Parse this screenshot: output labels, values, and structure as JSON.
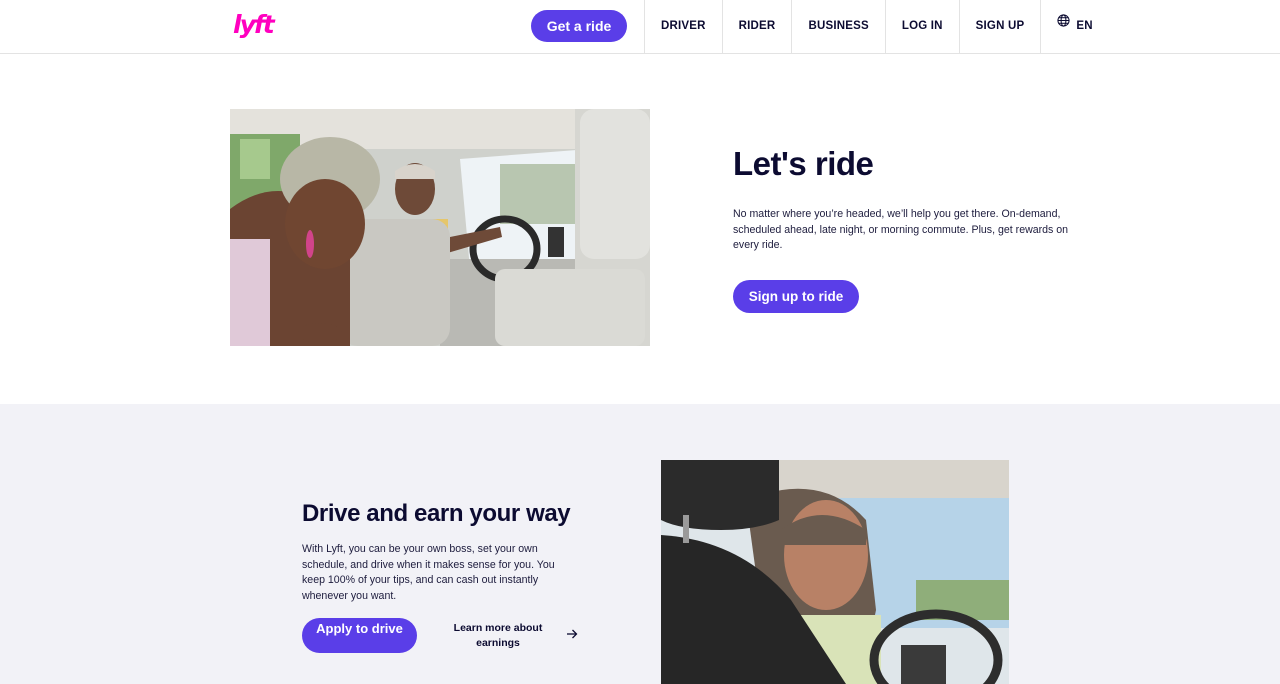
{
  "header": {
    "logo_text": "lyft",
    "get_ride_label": "Get a ride",
    "nav": [
      "DRIVER",
      "RIDER",
      "BUSINESS",
      "LOG IN",
      "SIGN UP"
    ],
    "language": "EN",
    "language_icon": "globe-icon"
  },
  "ride": {
    "title": "Let's ride",
    "description": "No matter where you’re headed, we’ll help you get there. On-demand, scheduled ahead, late night, or morning commute. Plus, get rewards on every ride.",
    "cta_label": "Sign up to ride"
  },
  "drive": {
    "title": "Drive and earn your way",
    "description": "With Lyft, you can be your own boss, set your own schedule, and drive when it makes sense for you. You keep 100% of your tips, and can cash out instantly whenever you want.",
    "apply_label": "Apply to drive",
    "learn_label": "Learn more about earnings",
    "arrow_icon": "arrow-right-icon"
  },
  "colors": {
    "brand_pink": "#ff00bf",
    "accent_purple": "#5a3ee8",
    "text_dark": "#0c0b31",
    "section_bg": "#f2f2f7"
  }
}
